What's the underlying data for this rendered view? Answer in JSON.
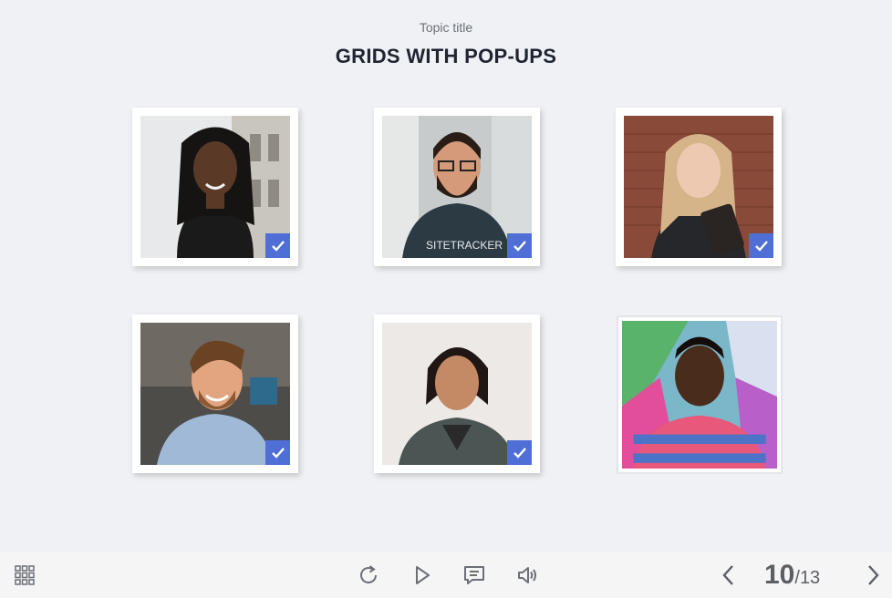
{
  "header": {
    "topic_title": "Topic title",
    "page_title": "GRIDS WITH POP-UPS"
  },
  "grid": {
    "items": [
      {
        "name": "person-1",
        "visited": true
      },
      {
        "name": "person-2",
        "visited": true
      },
      {
        "name": "person-3",
        "visited": true
      },
      {
        "name": "person-4",
        "visited": true
      },
      {
        "name": "person-5",
        "visited": true
      },
      {
        "name": "person-6",
        "visited": false
      }
    ],
    "check_icon": "checkmark-icon",
    "check_color": "#4f6fd6"
  },
  "toolbar": {
    "menu_icon": "grid-menu-icon",
    "replay_icon": "replay-icon",
    "play_icon": "play-icon",
    "notes_icon": "notes-icon",
    "audio_icon": "speaker-icon",
    "prev_icon": "chevron-left-icon",
    "next_icon": "chevron-right-icon",
    "current_slide": "10",
    "separator": "/",
    "total_slides": "13"
  }
}
